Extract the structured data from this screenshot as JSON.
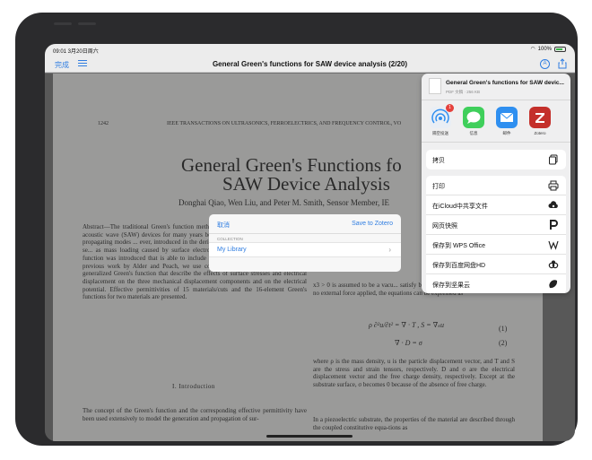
{
  "statusbar": {
    "time": "09:01  3月20日周六",
    "battery": "100%"
  },
  "navbar": {
    "done_label": "完成",
    "title": "General Green's functions for SAW device analysis (2/20)",
    "annotate_label": "A"
  },
  "paper": {
    "page_number": "1242",
    "running_header": "IEEE TRANSACTIONS ON ULTRASONICS, FERROELECTRICS, AND FREQUENCY CONTROL, VO",
    "title_line1": "General Green's Functions fo",
    "title_line2": "SAW Device Analysis",
    "authors": "Donghai Qiao, Wen Liu, and Peter M. Smith, Sensor Member, IE",
    "abstract": "Abstract—The traditional Green's function method is widely used to analyze surface acoustic wave (SAW) devices for many years because of its physical ... model many propagating modes ... ever, introduced in the derivatio... function that cause it to ignore se... as mass loading caused by surface electrodes. Recently, a generalized Green's function was introduced that is able to include mechanical loading effects. Based on previous work by Alder and Peach, we use concise matrix notation to deduce the generalized Green's function that describe the effects of surface stresses and electrical displacement on the three mechanical displacement components and on the electrical potential. Effective permittivities of 15 materials/cuts and the 16-element Green's functions for two materials are presented.",
    "right_col_1": "x3 > 0 is assumed to be a vacu... satisfy both Newton's equations ... If there is no external force applied, the equations can be expressed as",
    "eq1": "ρ ∂²u/∂t² = ∇ · T ,  S = ∇ₛu",
    "eq1_number": "(1)",
    "eq2": "∇ · D = σ",
    "eq2_number": "(2)",
    "right_col_2": "where ρ is the mass density, u is the particle displacement vector, and T and S are the stress and strain tensors, respectively. D and σ are the electrical displacement vector and the free charge density, respectively. Except at the substrate surface, σ becomes 0 because of the absence of free charge.",
    "section_heading": "I. Introduction",
    "left_col_2": "The concept of the Green's function and the corresponding effective permittivity have been used extensively to model the generation and propagation of sur-",
    "right_col_3": "In a piezoelectric substrate, the properties of the material are described through the coupled constitutive equa-tions as"
  },
  "zotero_dialog": {
    "cancel_label": "取消",
    "save_label": "Save to Zotero",
    "section_label": "COLLECTION",
    "library_label": "My Library"
  },
  "share_sheet": {
    "file_name": "General Green's functions for SAW devic...",
    "file_meta": "PDF 文稿 · 256 KB",
    "apps": [
      {
        "label": "隔空投送",
        "icon": "airdrop-icon",
        "badge": "1"
      },
      {
        "label": "信息",
        "icon": "messages-icon"
      },
      {
        "label": "邮件",
        "icon": "mail-icon"
      },
      {
        "label": "Zotero",
        "icon": "zotero-icon"
      }
    ],
    "copy_label": "拷贝",
    "actions": [
      {
        "label": "打印",
        "icon": "printer-icon"
      },
      {
        "label": "在iCloud中共享文件",
        "icon": "icloud-share-icon"
      },
      {
        "label": "网页快照",
        "icon": "snapshot-icon"
      },
      {
        "label": "保存到 WPS Office",
        "icon": "wps-icon"
      },
      {
        "label": "保存到百度网盘HD",
        "icon": "baidu-netdisk-icon"
      },
      {
        "label": "保存到坚果云",
        "icon": "jianguoyun-icon"
      }
    ]
  },
  "colors": {
    "accent": "#2f7de1",
    "zotero_red": "#c4302b",
    "messages_green": "#3fcf5b",
    "mail_blue": "#2f8ff0"
  }
}
